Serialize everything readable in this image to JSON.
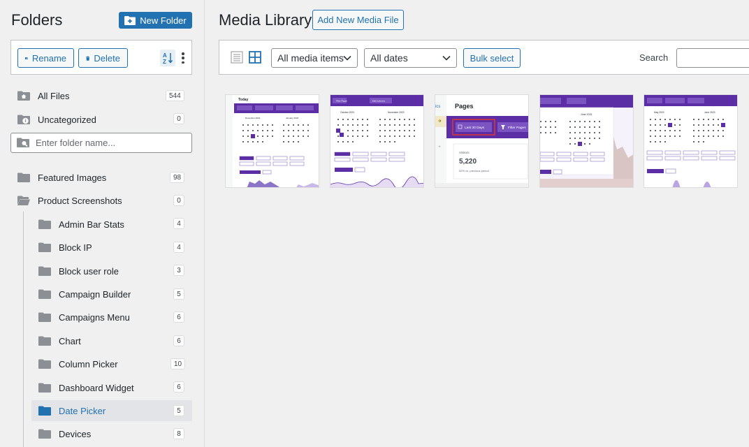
{
  "sidebar": {
    "title": "Folders",
    "new_folder_label": "New Folder",
    "rename_label": "Rename",
    "delete_label": "Delete",
    "folder_input_placeholder": "Enter folder name...",
    "top_items": [
      {
        "label": "All Files",
        "count": "544"
      },
      {
        "label": "Uncategorized",
        "count": "0"
      }
    ],
    "folders": [
      {
        "label": "Featured Images",
        "count": "98"
      },
      {
        "label": "Product Screenshots",
        "count": "0"
      }
    ],
    "subfolders": [
      {
        "label": "Admin Bar Stats",
        "count": "4"
      },
      {
        "label": "Block IP",
        "count": "4"
      },
      {
        "label": "Block user role",
        "count": "3"
      },
      {
        "label": "Campaign Builder",
        "count": "5"
      },
      {
        "label": "Campaigns Menu",
        "count": "6"
      },
      {
        "label": "Chart",
        "count": "6"
      },
      {
        "label": "Column Picker",
        "count": "10"
      },
      {
        "label": "Dashboard Widget",
        "count": "6"
      },
      {
        "label": "Date Picker",
        "count": "5",
        "selected": true
      },
      {
        "label": "Devices",
        "count": "8"
      }
    ]
  },
  "main": {
    "title": "Media Library",
    "add_media_label": "Add New Media File",
    "filter_media_value": "All media items",
    "filter_dates_value": "All dates",
    "bulk_select_label": "Bulk select",
    "search_label": "Search"
  },
  "thumbnails": {
    "t1": {
      "today": "Today",
      "m1": "December 2022",
      "m2": "January 2023"
    },
    "t2": {
      "m1": "October 2023",
      "m2": "November 2023",
      "tab": "Filter Pages",
      "tab2": "Edit Columns"
    },
    "t3": {
      "heading": "Pages",
      "side": "ics",
      "btn1": "Last 30 Days",
      "btn2": "Filter Pages",
      "stat_label": "Visitors",
      "stat_value": "5,220",
      "stat_note": "52% vs. previous period"
    },
    "t4": {
      "m1": "June 2023"
    },
    "t5": {
      "m1": "May 2023",
      "m2": "June 2023"
    }
  },
  "colors": {
    "accent": "#2271b1",
    "brand_purple": "#5b2ea6",
    "highlight_red": "#d63638",
    "folder_gray": "#8c8f94",
    "folder_selected": "#2271b1"
  }
}
